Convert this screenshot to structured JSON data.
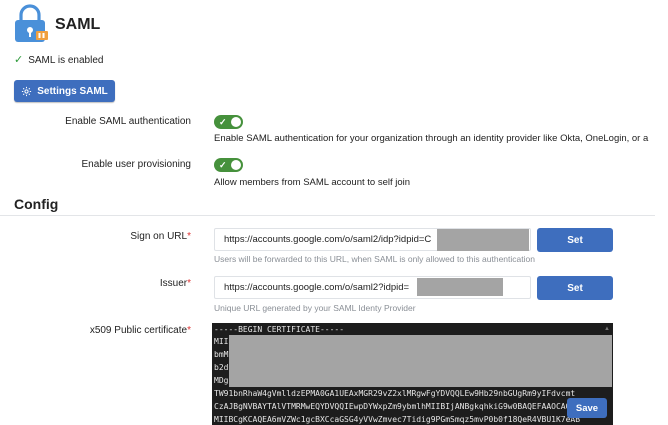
{
  "header": {
    "title": "SAML",
    "status_text": "SAML is enabled",
    "settings_button_label": "Settings SAML"
  },
  "enable_saml": {
    "label": "Enable SAML authentication",
    "enabled": true,
    "description": "Enable SAML authentication for your organization through an identity provider like Okta, OneLogin, or a"
  },
  "provisioning": {
    "label": "Enable user provisioning",
    "enabled": true,
    "description": "Allow members from SAML account to self join"
  },
  "config": {
    "section_title": "Config",
    "sign_on_url": {
      "label": "Sign on URL",
      "required_mark": "*",
      "value": "https://accounts.google.com/o/saml2/idp?idpid=C",
      "hint": "Users will be forwarded to this URL, when SAML is only allowed to this authentication",
      "button_label": "Set"
    },
    "issuer": {
      "label": "Issuer",
      "required_mark": "*",
      "value": "https://accounts.google.com/o/saml2?idpid=",
      "hint": "Unique URL generated by your SAML Identy Provider",
      "button_label": "Set"
    },
    "certificate": {
      "label": "x509 Public certificate",
      "required_mark": "*",
      "lines": [
        "-----BEGIN CERTIFICATE-----",
        "MII",
        "bmM",
        "b2d",
        "MDg",
        "TW91bnRhaW4gVmlldzEPMA0GA1UEAxMGR29vZ2xlMRgwFgYDVQQLEw9Hb29nbGUgRm9yIFdvcmt",
        "CzAJBgNVBAYTAlVTMRMwEQYDVQQIEwpDYWxpZm9ybmlhMIIBIjANBgkqhkiG9w0BAQEFAAOCAQ8",
        "MIIBCgKCAQEA6mVZWc1gcBXCcaGSG4yVVwZmvec7Tidig9PGmSmqz5mvP0b0f18QeR4VBU1K7eAB"
      ],
      "save_label": "Save"
    }
  },
  "colors": {
    "primary": "#3e6ebe",
    "toggle_on": "#46913c",
    "success": "#2e9a3a",
    "required": "#dd3333",
    "cert_bg": "#1d1d1d"
  },
  "icons": [
    "lock-icon",
    "check-icon",
    "gear-icon",
    "toggle-check-icon"
  ]
}
